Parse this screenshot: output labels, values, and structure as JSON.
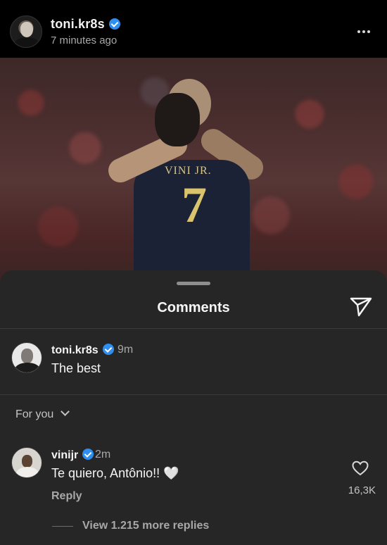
{
  "post": {
    "username": "toni.kr8s",
    "timestamp": "7 minutes ago"
  },
  "photo": {
    "jersey_name": "VINI JR.",
    "jersey_number": "7"
  },
  "comments_sheet": {
    "title": "Comments",
    "pinned_comment": {
      "username": "toni.kr8s",
      "time": "9m",
      "text": "The best"
    },
    "filter_label": "For you",
    "comment": {
      "username": "vinijr",
      "time": "2m",
      "text": "Te quiero, Antônio!! 🤍",
      "reply_label": "Reply",
      "like_count": "16,3K",
      "view_replies_label": "View 1.215 more replies"
    }
  },
  "icons": [
    "more-icon",
    "verified-badge-icon",
    "send-icon",
    "chevron-down-icon",
    "heart-icon"
  ],
  "colors": {
    "background": "#000000",
    "sheet": "#262626",
    "verified": "#2f8ff0",
    "secondary_text": "#a8a8a8"
  }
}
